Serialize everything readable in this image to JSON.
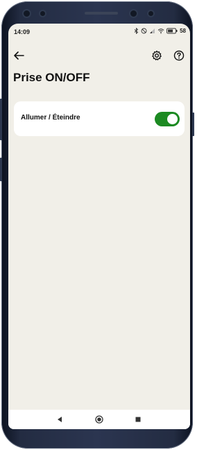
{
  "status_bar": {
    "time": "14:09",
    "battery_percent": "58",
    "icons": [
      "bluetooth-icon",
      "dnd-icon",
      "signal-icon",
      "wifi-icon",
      "battery-icon"
    ]
  },
  "app_bar": {
    "back_icon": "back-arrow-icon",
    "settings_icon": "gear-icon",
    "help_icon": "help-icon"
  },
  "page": {
    "title": "Prise ON/OFF"
  },
  "settings_card": {
    "label": "Allumer / Éteindre",
    "toggle_on": true,
    "toggle_color": "#1c8a22"
  },
  "nav_bar": {
    "icons": [
      "back-triangle-icon",
      "home-circle-icon",
      "recents-square-icon"
    ]
  },
  "colors": {
    "background": "#f1efe8",
    "card": "#ffffff",
    "accent": "#1c8a22"
  }
}
